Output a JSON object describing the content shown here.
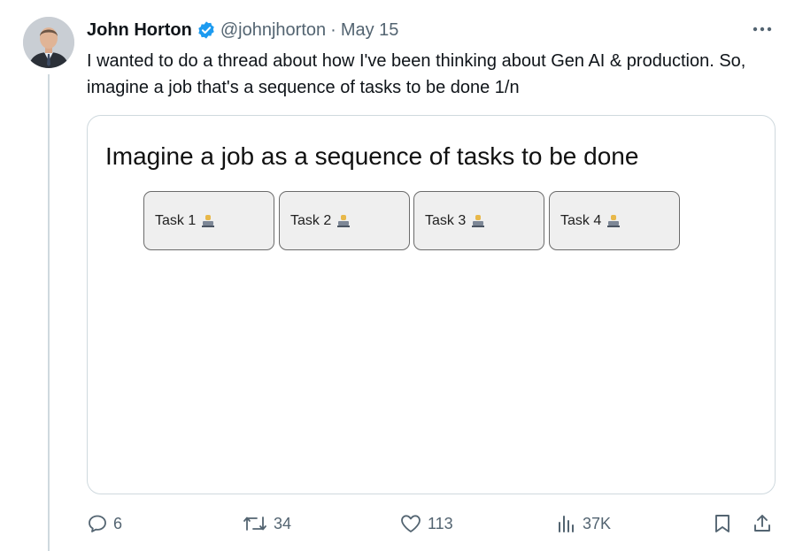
{
  "author": {
    "name": "John Horton",
    "handle": "@johnjhorton",
    "separator": "·",
    "date": "May 15",
    "verified_color": "#1d9bf0"
  },
  "tweet": {
    "text": "I wanted to do a thread about how I've been thinking about Gen AI & production. So, imagine a job that's a sequence of tasks to be done 1/n"
  },
  "media": {
    "title": "Imagine a job as a sequence of tasks to be done",
    "tasks": [
      {
        "label": "Task 1",
        "icon": "technologist-emoji"
      },
      {
        "label": "Task 2",
        "icon": "technologist-emoji"
      },
      {
        "label": "Task 3",
        "icon": "technologist-emoji"
      },
      {
        "label": "Task 4",
        "icon": "technologist-emoji"
      }
    ]
  },
  "actions": {
    "replies": "6",
    "retweets": "34",
    "likes": "113",
    "views": "37K",
    "icons": [
      "reply-icon",
      "retweet-icon",
      "like-icon",
      "views-icon",
      "bookmark-icon",
      "share-icon"
    ]
  }
}
